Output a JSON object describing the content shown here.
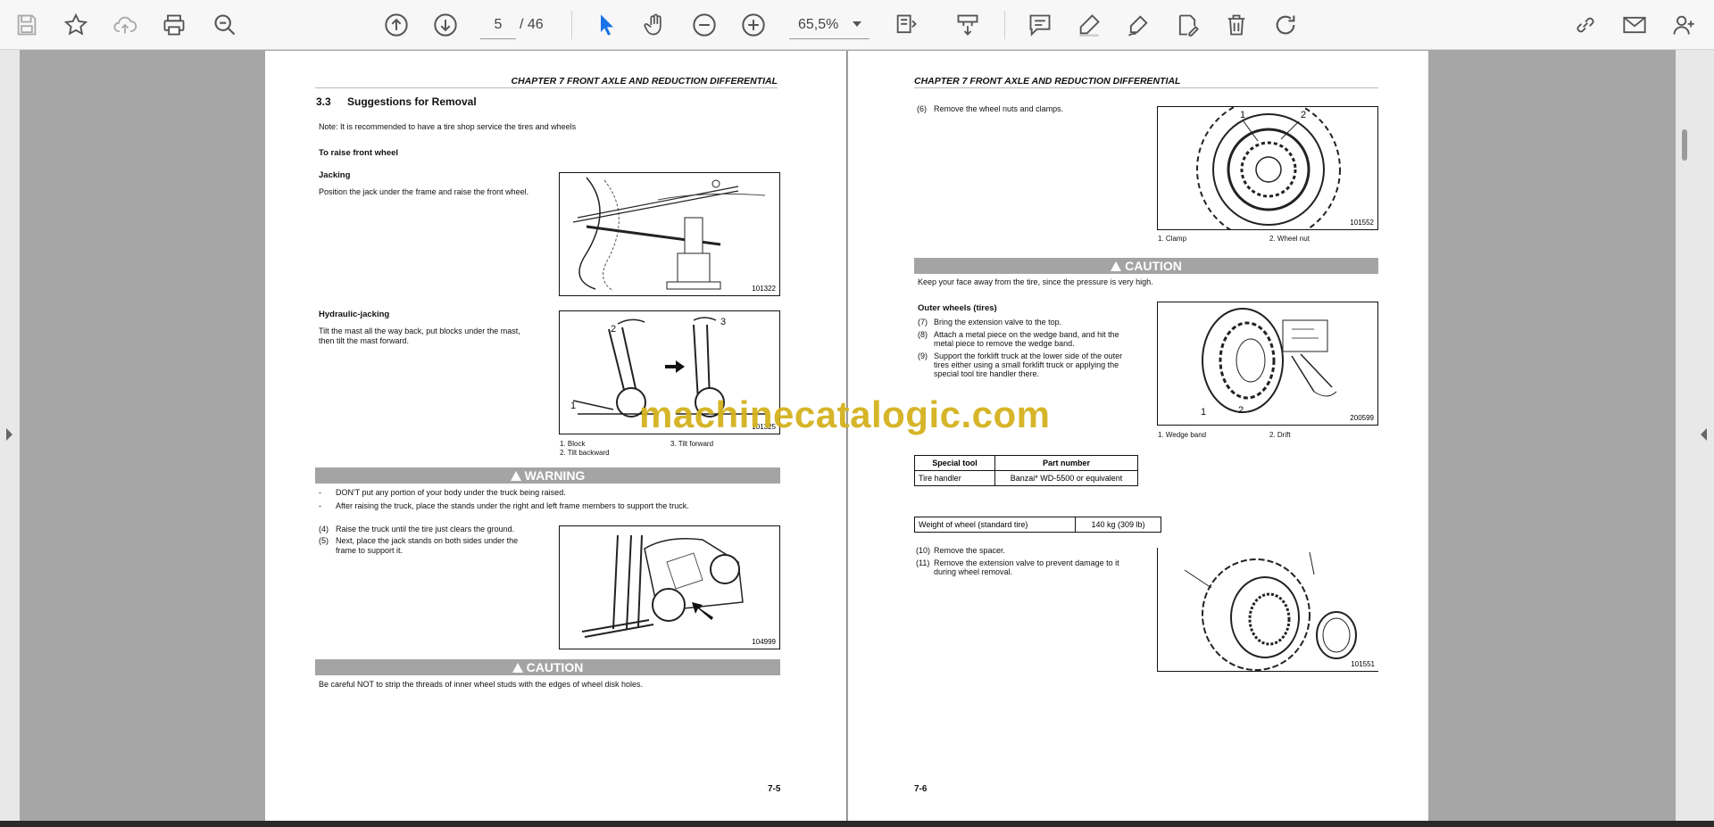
{
  "toolbar": {
    "current_page": "5",
    "page_separator": "/",
    "total_pages": "46",
    "zoom": "65,5%"
  },
  "colors": {
    "accent": "#1a73e8",
    "banner": "#a4a4a4",
    "watermark": "#d4b21e"
  },
  "watermark": "machinecatalogic.com",
  "left_page": {
    "chapter": "CHAPTER 7 FRONT AXLE AND REDUCTION DIFFERENTIAL",
    "section_num": "3.3",
    "section_title": "Suggestions for Removal",
    "note": "Note: It is recommended to have a tire shop service the tires and wheels",
    "raise_heading": "To raise front wheel",
    "jacking_heading": "Jacking",
    "jacking_text": "Position the jack under the frame and raise the front wheel.",
    "fig1_code": "101322",
    "hydraulic_heading": "Hydraulic-jacking",
    "hydraulic_text_1": "Tilt the mast all the way back, put blocks under the mast,",
    "hydraulic_text_2": "then tilt the mast forward.",
    "fig2_code": "101325",
    "fig2_labels": [
      "1",
      "2",
      "3"
    ],
    "fig2_legend_1": "1. Block",
    "fig2_legend_2": "2. Tilt backward",
    "fig2_legend_3": "3. Tilt forward",
    "warning_title": "WARNING",
    "warning_1": "DON'T put any portion of your body under the truck being raised.",
    "warning_2": "After raising the truck, place the stands under the right and left frame members to support the truck.",
    "dash": "-",
    "step4_num": "(4)",
    "step4": "Raise the truck until the tire just clears the ground.",
    "step5_num": "(5)",
    "step5_a": "Next, place the jack stands on both sides under the",
    "step5_b": "frame to support it.",
    "fig3_code": "104999",
    "caution_title": "CAUTION",
    "caution_text": "Be careful NOT to strip the threads of inner wheel studs with the edges of wheel disk holes.",
    "page_number": "7-5"
  },
  "right_page": {
    "chapter": "CHAPTER 7 FRONT AXLE AND REDUCTION DIFFERENTIAL",
    "step6_num": "(6)",
    "step6": "Remove the wheel nuts and clamps.",
    "fig4_code": "101552",
    "fig4_labels": [
      "1",
      "2"
    ],
    "fig4_legend_1": "1. Clamp",
    "fig4_legend_2": "2. Wheel nut",
    "caution_title": "CAUTION",
    "caution_text": "Keep your face away from the tire, since the pressure is very high.",
    "outer_heading": "Outer wheels (tires)",
    "step7_num": "(7)",
    "step7": "Bring the extension valve to the top.",
    "step8_num": "(8)",
    "step8_a": "Attach a metal piece on the wedge band, and hit the",
    "step8_b": "metal piece to remove the wedge band.",
    "step9_num": "(9)",
    "step9_a": "Support the forklift truck at the lower side of the outer",
    "step9_b": "tires either using a small forklift truck or applying the",
    "step9_c": "special tool tire handler there.",
    "fig5_code": "200599",
    "fig5_labels": [
      "1",
      "2"
    ],
    "fig5_legend_1": "1. Wedge band",
    "fig5_legend_2": "2. Drift",
    "tool_table": {
      "headers": [
        "Special tool",
        "Part number"
      ],
      "rows": [
        [
          "Tire handler",
          "Banzai* WD-5500 or equivalent"
        ]
      ]
    },
    "weight_label": "Weight of wheel (standard tire)",
    "weight_value": "140 kg (309 lb)",
    "step10_num": "(10)",
    "step10": "Remove the spacer.",
    "step11_num": "(11)",
    "step11_a": "Remove the extension valve to prevent damage to it",
    "step11_b": "during wheel removal.",
    "fig6_code": "101551",
    "page_number": "7-6"
  }
}
